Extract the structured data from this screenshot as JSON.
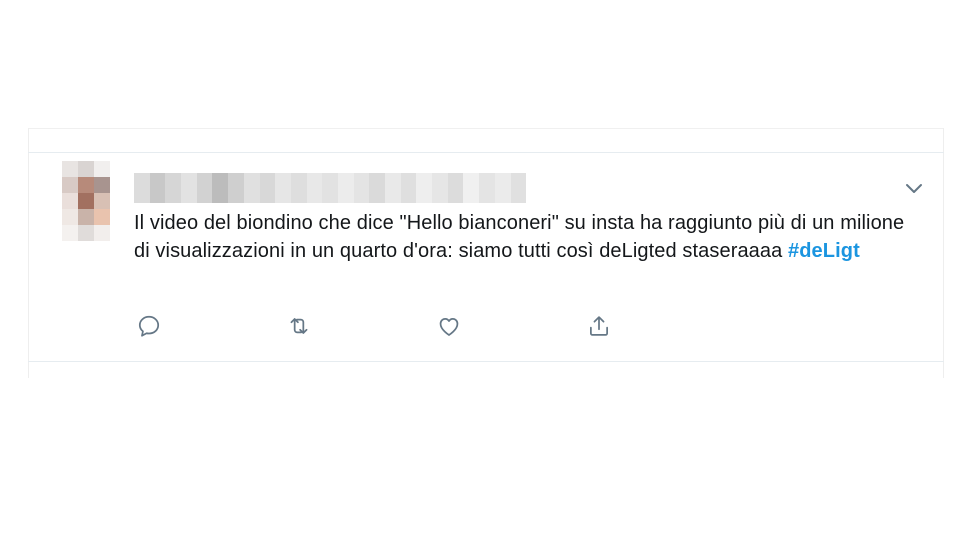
{
  "tweet": {
    "text": "Il video del biondino che dice \"Hello bianconeri\" su insta ha raggiunto più di un milione di visualizzazioni in un quarto d'ora: siamo tutti così deLigted staseraaaa ",
    "hashtag": "#deLigt"
  },
  "icons": {
    "caret": "chevron-down-icon",
    "reply": "reply-icon",
    "retweet": "retweet-icon",
    "like": "heart-icon",
    "share": "share-icon"
  },
  "colors": {
    "text": "#14171a",
    "hashtag": "#1b95e0",
    "icon": "#657786",
    "divider": "#e6ecf0"
  },
  "avatar_pixels": [
    "#e8e4e2",
    "#d9d4d2",
    "#f1efee",
    "#d8cac5",
    "#b78a7a",
    "#a8948f",
    "#eadfdb",
    "#a27060",
    "#d8c0b4",
    "#efe8e4",
    "#c9b3a9",
    "#e9c3ae",
    "#f4f1ef",
    "#e0dcda",
    "#f2eeec",
    "#ffffff",
    "#ffffff",
    "#ffffff"
  ],
  "name_pixels": [
    "#dcdcdc",
    "#c8c8c8",
    "#d6d6d6",
    "#e2e2e2",
    "#d2d2d2",
    "#bcbcbc",
    "#cfcfcf",
    "#e0e0e0",
    "#d8d8d8",
    "#e6e6e6",
    "#dedede",
    "#e8e8e8",
    "#e2e2e2",
    "#ececec",
    "#e4e4e4",
    "#dadada",
    "#e9e9e9",
    "#dfdfdf",
    "#eeeeee",
    "#e6e6e6",
    "#dcdcdc",
    "#f0f0f0",
    "#e4e4e4",
    "#ebebeb",
    "#e0e0e0"
  ]
}
